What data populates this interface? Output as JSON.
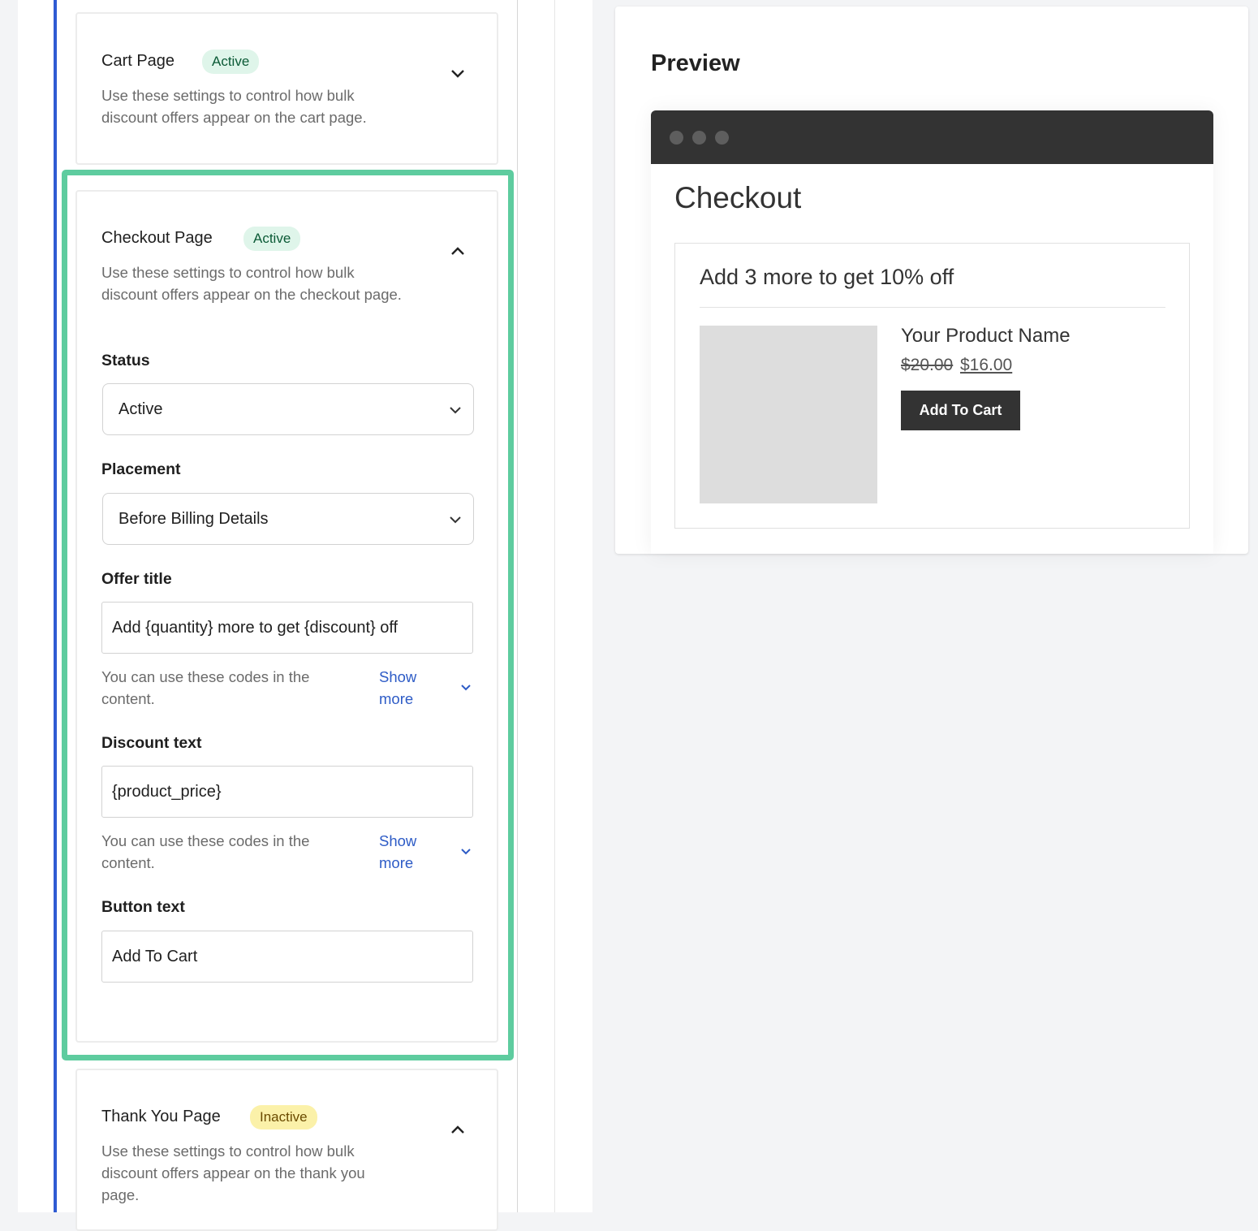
{
  "settings": {
    "cart": {
      "title": "Cart Page",
      "status_badge": "Active",
      "description": "Use these settings to control how bulk discount offers appear on the cart page.",
      "expanded": false
    },
    "checkout": {
      "title": "Checkout Page",
      "status_badge": "Active",
      "description": "Use these settings to control how bulk discount offers appear on the checkout page.",
      "expanded": true,
      "fields": {
        "status": {
          "label": "Status",
          "value": "Active"
        },
        "placement": {
          "label": "Placement",
          "value": "Before Billing Details"
        },
        "offer_title": {
          "label": "Offer title",
          "value": "Add {quantity} more to get {discount} off",
          "help": "You can use these codes in the content.",
          "show_more": "Show more"
        },
        "discount_text": {
          "label": "Discount text",
          "value": "{product_price}",
          "help": "You can use these codes in the content.",
          "show_more": "Show more"
        },
        "button_text": {
          "label": "Button text",
          "value": "Add To Cart"
        }
      }
    },
    "thank_you": {
      "title": "Thank You Page",
      "status_badge": "Inactive",
      "description": "Use these settings to control how bulk discount offers appear on the thank you page.",
      "expanded": true
    }
  },
  "preview": {
    "title": "Preview",
    "page_heading": "Checkout",
    "offer_title": "Add 3 more to get 10% off",
    "product_name": "Your Product Name",
    "price_old": "$20.00",
    "price_new": "$16.00",
    "button_label": "Add To Cart"
  },
  "colors": {
    "highlight": "#5ecc9f",
    "accent_blue": "#2f5bd3",
    "link": "#2d5bc6",
    "active_badge_bg": "#dff5ea",
    "inactive_badge_bg": "#fbf1a9"
  }
}
